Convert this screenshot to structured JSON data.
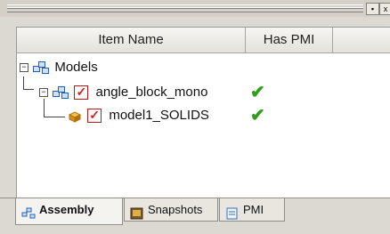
{
  "panel": {
    "pin_glyph": "▪",
    "close_glyph": "x"
  },
  "grid": {
    "columns": [
      "Item Name",
      "Has PMI"
    ],
    "rows": [
      {
        "label": "Models",
        "icon": "assembly-icon",
        "has_pmi": ""
      },
      {
        "label": "angle_block_mono",
        "icon": "assembly-icon",
        "has_pmi": "✔"
      },
      {
        "label": "model1_SOLIDS",
        "icon": "part-icon",
        "has_pmi": "✔"
      }
    ],
    "colors": {
      "check_green": "#2f9e1b",
      "visibility_red": "#d61f1f"
    }
  },
  "tabs": [
    {
      "label": "Assembly",
      "icon": "assembly-icon",
      "active": true
    },
    {
      "label": "Snapshots",
      "icon": "snapshot-icon",
      "active": false
    },
    {
      "label": "PMI",
      "icon": "pmi-doc-icon",
      "active": false
    }
  ],
  "tree": {
    "expand_glyph": "−",
    "visible_glyph": "✓"
  }
}
